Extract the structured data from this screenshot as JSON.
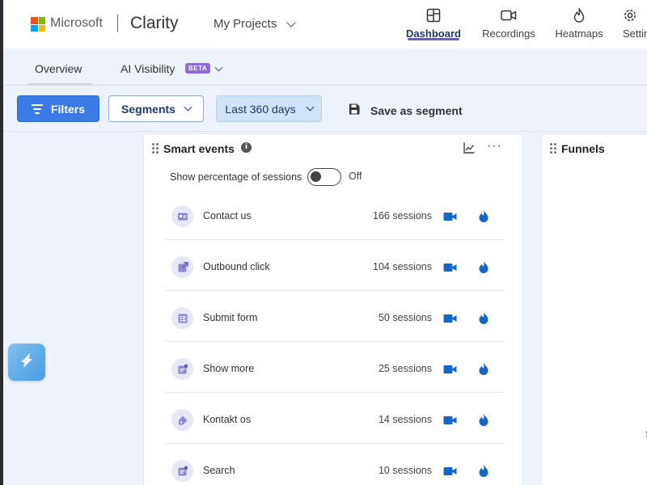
{
  "header": {
    "company": "Microsoft",
    "product": "Clarity",
    "projects_label": "My Projects",
    "logo_colors": [
      "#f25022",
      "#7fba00",
      "#00a4ef",
      "#ffb900"
    ],
    "accent": "#6a5acd",
    "nav": [
      {
        "label": "Dashboard",
        "icon": "dashboard-icon",
        "active": true
      },
      {
        "label": "Recordings",
        "icon": "video-camera-icon",
        "active": false
      },
      {
        "label": "Heatmaps",
        "icon": "flame-icon",
        "active": false
      },
      {
        "label": "Settin",
        "icon": "gear-icon",
        "active": false
      }
    ]
  },
  "tabs": {
    "overview": "Overview",
    "ai_visibility": "AI Visibility",
    "beta_badge": "BETA"
  },
  "filters": {
    "filters_label": "Filters",
    "segments_label": "Segments",
    "date_range": "Last 360 days",
    "save_segment_label": "Save as segment",
    "primary_color": "#3b7be6"
  },
  "smart_events": {
    "title": "Smart events",
    "show_percentage_label": "Show percentage of sessions",
    "toggle_state": "Off",
    "events": [
      {
        "name": "Contact us",
        "sessions": "166 sessions",
        "icon": "contact-card-icon"
      },
      {
        "name": "Outbound click",
        "sessions": "104 sessions",
        "icon": "outbound-link-icon"
      },
      {
        "name": "Submit form",
        "sessions": "50 sessions",
        "icon": "form-icon"
      },
      {
        "name": "Show more",
        "sessions": "25 sessions",
        "icon": "expand-content-icon"
      },
      {
        "name": "Kontakt os",
        "sessions": "14 sessions",
        "icon": "tag-icon"
      },
      {
        "name": "Search",
        "sessions": "10 sessions",
        "icon": "search-form-icon"
      }
    ]
  },
  "funnels": {
    "title": "Funnels",
    "fragment": "S"
  }
}
